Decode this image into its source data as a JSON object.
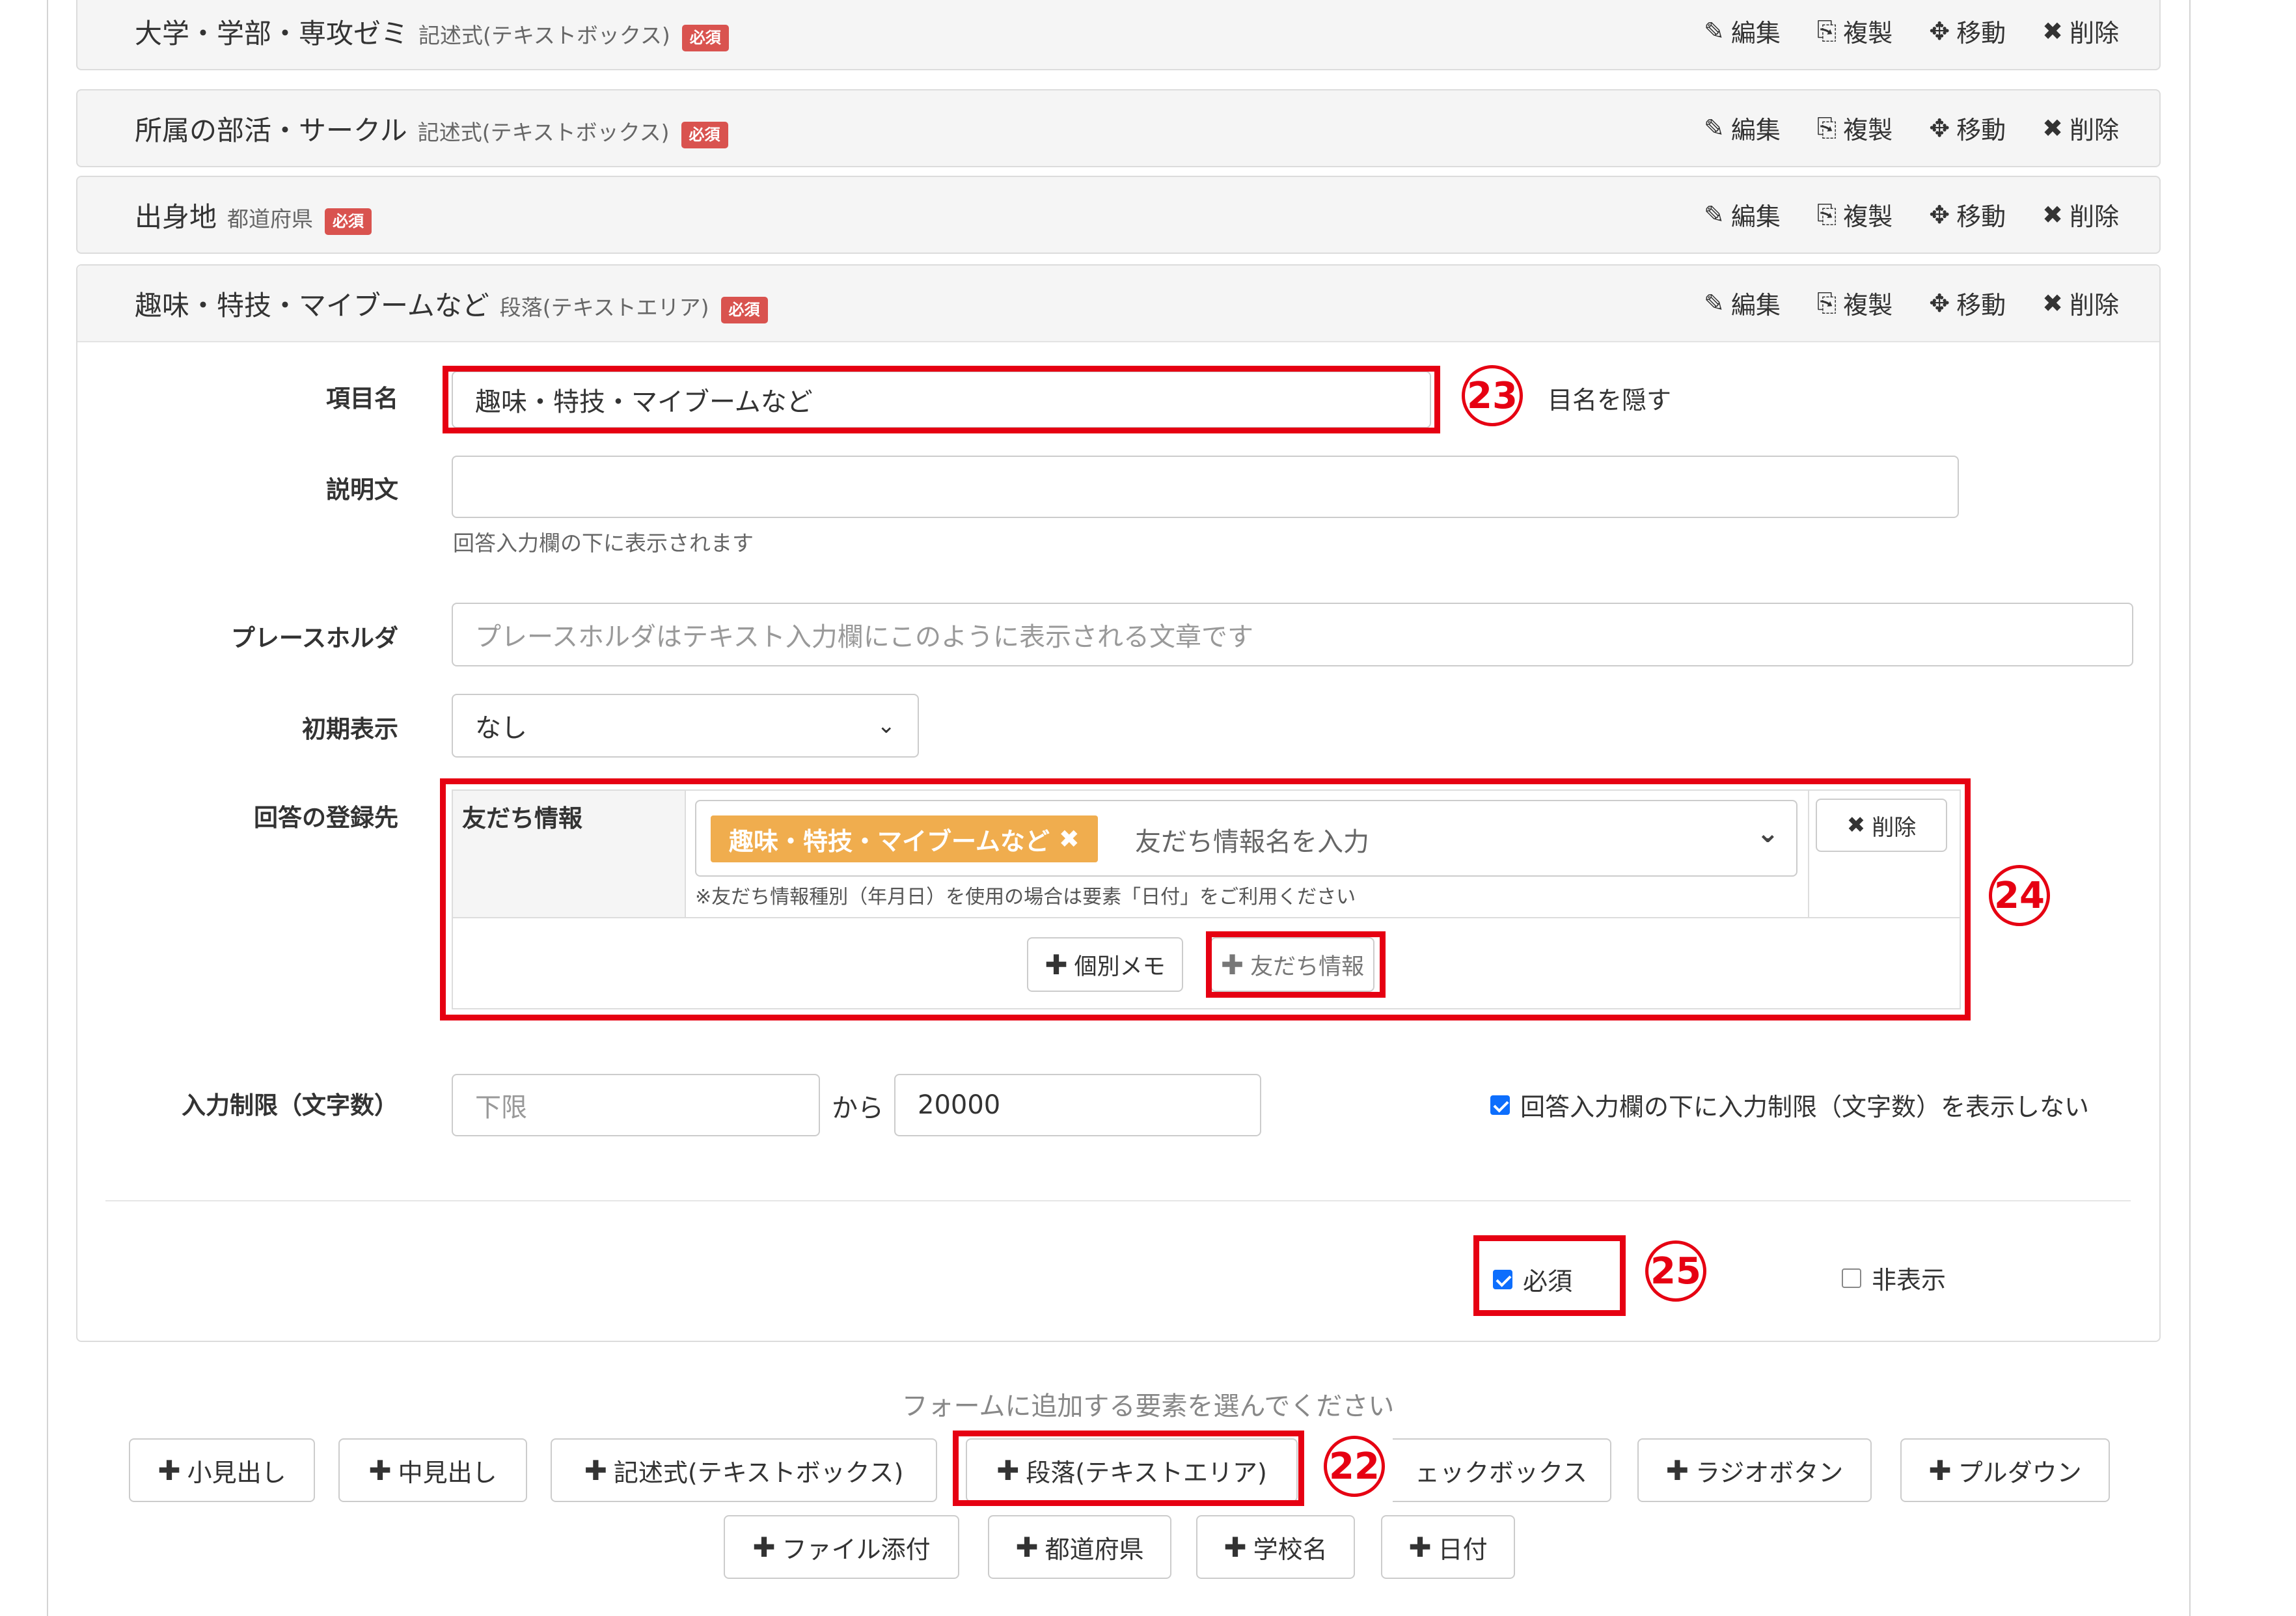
{
  "rows": [
    {
      "title": "大学・学部・専攻ゼミ",
      "type": "記述式(テキストボックス)",
      "badge": "必須"
    },
    {
      "title": "所属の部活・サークル",
      "type": "記述式(テキストボックス)",
      "badge": "必須"
    },
    {
      "title": "出身地",
      "type": "都道府県",
      "badge": "必須"
    },
    {
      "title": "趣味・特技・マイブームなど",
      "type": "段落(テキストエリア)",
      "badge": "必須"
    }
  ],
  "actions": {
    "edit": "編集",
    "copy": "複製",
    "move": "移動",
    "delete": "削除"
  },
  "form": {
    "item_name_label": "項目名",
    "item_name_value": "趣味・特技・マイブームなど",
    "hide_name_label": "目名を隠す",
    "description_label": "説明文",
    "description_value": "",
    "description_help": "回答入力欄の下に表示されます",
    "placeholder_label": "プレースホルダ",
    "placeholder_placeholder": "プレースホルダはテキスト入力欄にこのように表示される文章です",
    "initial_label": "初期表示",
    "initial_value": "なし",
    "register_label": "回答の登録先",
    "friend_info_label": "友だち情報",
    "tag_label": "趣味・特技・マイブームなど",
    "friend_info_placeholder": "友だち情報名を入力",
    "friend_info_note": "※友だち情報種別（年月日）を使用の場合は要素「日付」をご利用ください",
    "delete_button": "削除",
    "memo_button": "個別メモ",
    "friend_info_button": "友だち情報",
    "limit_label": "入力制限（文字数）",
    "limit_min_placeholder": "下限",
    "limit_from": "から",
    "limit_max_value": "20000",
    "hide_limit_label": "回答入力欄の下に入力制限（文字数）を表示しない",
    "hide_limit_checked": true,
    "required_label": "必須",
    "required_checked": true,
    "hidden_label": "非表示",
    "hidden_checked": false
  },
  "annotations": {
    "n22": "22",
    "n23": "23",
    "n24": "24",
    "n25": "25"
  },
  "add_prompt": "フォームに追加する要素を選んでください",
  "add_buttons_row1": [
    "小見出し",
    "中見出し",
    "記述式(テキストボックス)",
    "段落(テキストエリア)",
    "ェックボックス",
    "ラジオボタン",
    "プルダウン"
  ],
  "add_buttons_row2": [
    "ファイル添付",
    "都道府県",
    "学校名",
    "日付"
  ],
  "colors": {
    "annotation": "#e60012",
    "badge": "#d9534f",
    "tag": "#f0ad4e",
    "checkbox": "#0d6efd"
  }
}
